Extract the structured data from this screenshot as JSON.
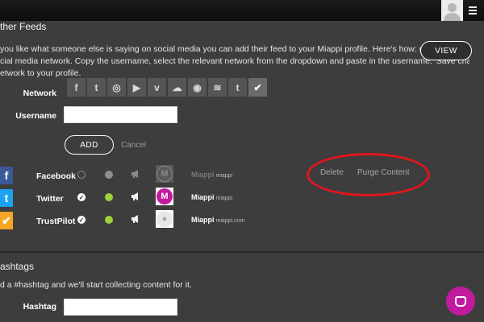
{
  "feeds": {
    "title": "ther Feeds",
    "intro_lines": [
      "you like what someone else is saying on social media you can add their feed to your Miappi profile. Here's how: navigate to their pro",
      "cial media network. Copy the username, select the relevant network from the dropdown and paste in the username. 'Save changes' t",
      "etwork to your profile."
    ],
    "view_button": "VIEW",
    "network_label": "Network",
    "network_icons": [
      {
        "name": "facebook-icon",
        "glyph": "f"
      },
      {
        "name": "twitter-icon",
        "glyph": "t"
      },
      {
        "name": "instagram-icon",
        "glyph": "◎"
      },
      {
        "name": "youtube-icon",
        "glyph": "▶"
      },
      {
        "name": "vimeo-icon",
        "glyph": "v"
      },
      {
        "name": "soundcloud-icon",
        "glyph": "☁"
      },
      {
        "name": "spotify-icon",
        "glyph": "◉"
      },
      {
        "name": "rss-icon",
        "glyph": "≋"
      },
      {
        "name": "tumblr-icon",
        "glyph": "t"
      },
      {
        "name": "trustpilot-icon",
        "glyph": "✔"
      }
    ],
    "username_label": "Username",
    "username_value": "",
    "add_button": "ADD",
    "cancel_link": "Cancel",
    "rows": [
      {
        "network": "Facebook",
        "icon": "facebook-icon",
        "icon_glyph": "f",
        "icon_color": "#3b5998",
        "active": false,
        "status_on": false,
        "account": "Miappi",
        "account_sub": "miappi",
        "dim": true
      },
      {
        "network": "Twitter",
        "icon": "twitter-icon",
        "icon_glyph": "t",
        "icon_color": "#1da1f2",
        "active": true,
        "status_on": true,
        "account": "Miappi",
        "account_sub": "miappi",
        "dim": false
      },
      {
        "network": "TrustPilot",
        "icon": "trustpilot-icon",
        "icon_glyph": "✔",
        "icon_color": "#f5a623",
        "active": true,
        "status_on": true,
        "account": "Miappi",
        "account_sub": "miappi.com",
        "dim": false
      }
    ],
    "delete_label": "Delete",
    "purge_label": "Purge Content"
  },
  "hashtags": {
    "title": "ashtags",
    "intro": "d a #hashtag and we'll start collecting content for it.",
    "hashtag_label": "Hashtag",
    "hashtag_value": ""
  },
  "colors": {
    "accent": "#c21a9f",
    "highlight": "#e0161b",
    "active_dot": "#9bd33f"
  }
}
